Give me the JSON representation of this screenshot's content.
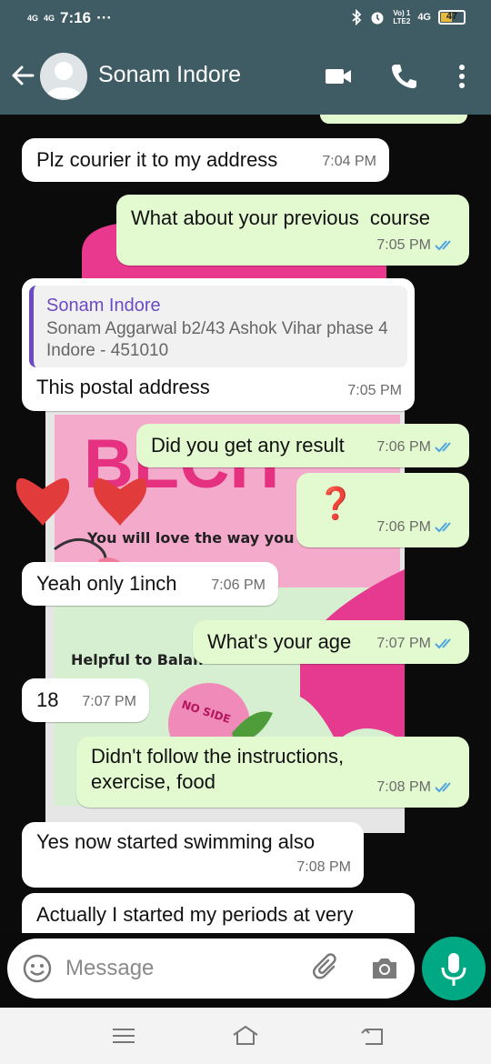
{
  "status_bar": {
    "network_left": "4G",
    "network_left2": "4G",
    "time": "7:16",
    "more": "···",
    "volte_label": "Vo) 1\nLTE2",
    "network_right": "4G",
    "battery": "47"
  },
  "header": {
    "contact_name": "Sonam Indore",
    "icons": [
      "back-arrow-icon",
      "avatar",
      "video-call-icon",
      "phone-icon",
      "more-vert-icon"
    ]
  },
  "messages": [
    {
      "dir": "in",
      "text": "Plz courier it to my address",
      "time": "7:04 PM"
    },
    {
      "dir": "out",
      "text": "What about your previous  course",
      "time": "7:05 PM",
      "read": true
    },
    {
      "dir": "in",
      "quote_name": "Sonam Indore",
      "quote_text": "Sonam Aggarwal  b2/43 Ashok Vihar phase 4 Indore - 451010",
      "text": "This postal address",
      "time": "7:05 PM"
    },
    {
      "dir": "out",
      "text": "Did you get any result",
      "time": "7:06 PM",
      "read": true
    },
    {
      "dir": "out",
      "text": "❓",
      "time": "7:06 PM",
      "read": true
    },
    {
      "dir": "in",
      "text": "Yeah only 1inch",
      "time": "7:06 PM"
    },
    {
      "dir": "out",
      "text": "What's your age",
      "time": "7:07 PM",
      "read": true
    },
    {
      "dir": "in",
      "text": "18",
      "time": "7:07 PM"
    },
    {
      "dir": "out",
      "text": "Didn't follow the instructions, exercise,  food",
      "time": "7:08 PM",
      "read": true
    },
    {
      "dir": "in",
      "text": "Yes  now started swimming also",
      "time": "7:08 PM"
    },
    {
      "dir": "in",
      "text": "Actually I started my periods at very",
      "time": ""
    }
  ],
  "wallpaper": {
    "brand": "BECH",
    "tagline": "You will love the way you lo",
    "sub": "Helpful to Balan",
    "badge": "NO SIDE"
  },
  "input": {
    "placeholder": "Message",
    "value": ""
  },
  "colors": {
    "header": "#3f5c65",
    "incoming": "#ffffff",
    "outgoing": "#e3fad0",
    "read_ticks": "#4fa3e0",
    "mic_button": "#00a884",
    "quote_accent": "#6b4bc3"
  }
}
